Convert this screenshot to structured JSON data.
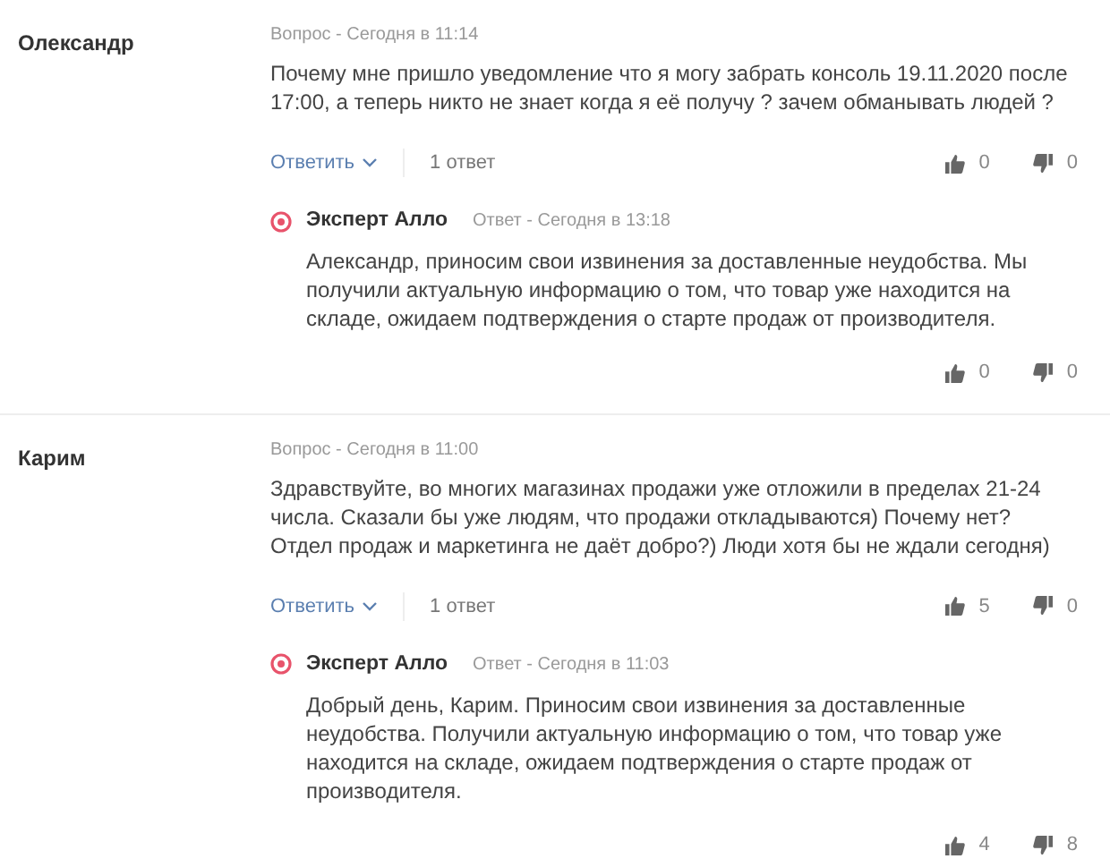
{
  "questions": [
    {
      "author": "Олександр",
      "meta": "Вопрос - Сегодня в 11:14",
      "text": "Почему мне пришло уведомление что я могу забрать консоль 19.11.2020 после 17:00, а теперь никто не знает когда я её получу ? зачем обманывать людей ?",
      "reply_label": "Ответить",
      "answers_count": "1 ответ",
      "likes": "0",
      "dislikes": "0",
      "answer": {
        "author": "Эксперт Алло",
        "meta": "Ответ - Сегодня в 13:18",
        "text": "Александр, приносим свои извинения за доставленные неудобства. Мы получили актуальную информацию о том, что товар уже находится на складе, ожидаем подтверждения о старте продаж от производителя.",
        "likes": "0",
        "dislikes": "0"
      }
    },
    {
      "author": "Карим",
      "meta": "Вопрос - Сегодня в 11:00",
      "text": "Здравствуйте, во многих магазинах продажи уже отложили в пределах 21-24 числа. Сказали бы уже людям, что продажи откладываются) Почему нет? Отдел продаж и маркетинга не даёт добро?) Люди хотя бы не ждали сегодня)",
      "reply_label": "Ответить",
      "answers_count": "1 ответ",
      "likes": "5",
      "dislikes": "0",
      "answer": {
        "author": "Эксперт Алло",
        "meta": "Ответ - Сегодня в 11:03",
        "text": "Добрый день, Карим. Приносим свои извинения за доставленные неудобства. Получили актуальную информацию о том, что товар уже находится на складе, ожидаем подтверждения о старте продаж от производителя.",
        "likes": "4",
        "dislikes": "8"
      }
    }
  ]
}
